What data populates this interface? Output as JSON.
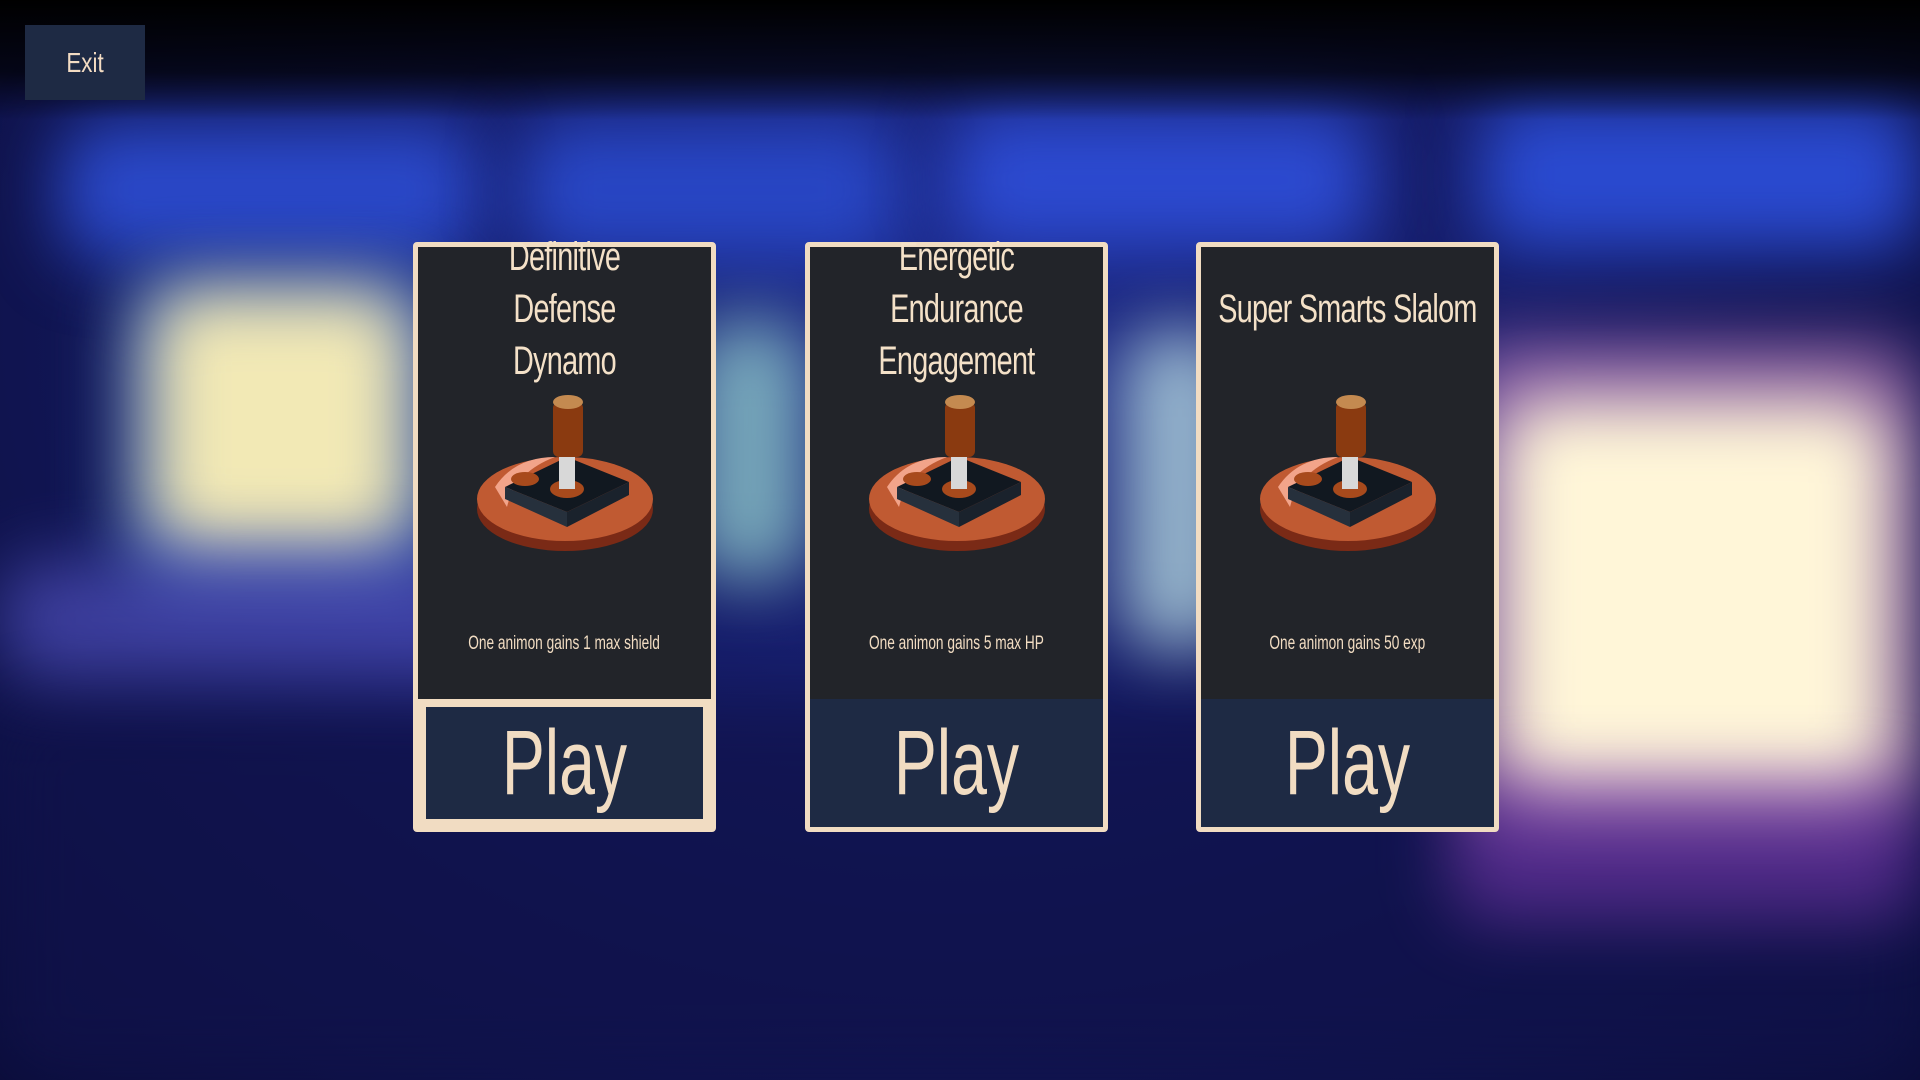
{
  "exit_label": "Exit",
  "cards": [
    {
      "title": "Definitive Defense Dynamo",
      "description": "One animon gains 1 max shield",
      "play_label": "Play",
      "icon": "joystick-icon"
    },
    {
      "title": "Energetic Endurance Engagement",
      "description": "One animon gains 5 max HP",
      "play_label": "Play",
      "icon": "joystick-icon"
    },
    {
      "title": "Super Smarts Slalom",
      "description": "One animon gains 50 exp",
      "play_label": "Play",
      "icon": "joystick-icon"
    }
  ],
  "colors": {
    "card_bg": "#222429",
    "card_border": "#f1dcc2",
    "button_bg": "#1e2a44",
    "text": "#f1dcc2"
  }
}
